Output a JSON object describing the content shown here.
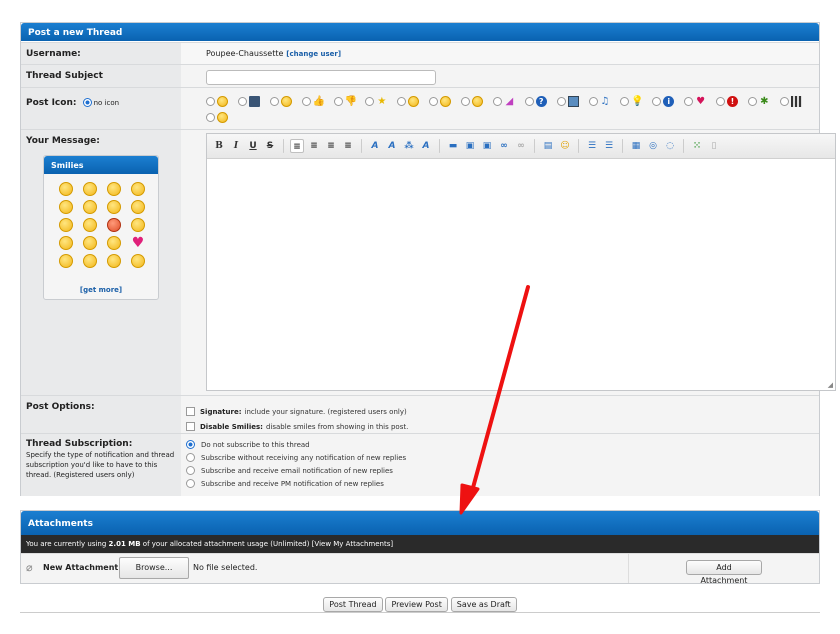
{
  "thread_form": {
    "header": "Post a new Thread",
    "username_label": "Username:",
    "username_value": "Poupee-Chaussette",
    "change_user": "[change user]",
    "subject_label": "Thread Subject",
    "subject_value": "",
    "post_icon_label": "Post Icon:",
    "no_icon": "no icon",
    "message_label": "Your Message:"
  },
  "smilies": {
    "header": "Smilies",
    "get_more": "[get more]"
  },
  "toolbar": {
    "bold": "B",
    "italic": "I",
    "underline": "U",
    "strike": "S"
  },
  "options": {
    "post_options_label": "Post Options:",
    "signature_bold": "Signature:",
    "signature_text": "include your signature. (registered users only)",
    "smilies_bold": "Disable Smilies:",
    "smilies_text": "disable smiles from showing in this post.",
    "subscription_label": "Thread Subscription:",
    "subscription_desc": "Specify the type of notification and thread subscription you'd like to have to this thread. (Registered users only)",
    "subscription_choices": [
      "Do not subscribe to this thread",
      "Subscribe without receiving any notification of new replies",
      "Subscribe and receive email notification of new replies",
      "Subscribe and receive PM notification of new replies"
    ]
  },
  "attachments": {
    "header": "Attachments",
    "usage_prefix": "You are currently using",
    "usage_amount": "2.01 MB",
    "usage_suffix": "of your allocated attachment usage (Unlimited)",
    "view_link": "[View My Attachments]",
    "new_label": "New Attachment:",
    "browse": "Browse...",
    "no_file": "No file selected.",
    "add_button": "Add Attachment"
  },
  "actions": {
    "post": "Post Thread",
    "preview": "Preview Post",
    "draft": "Save as Draft"
  },
  "colors": {
    "header_blue": "#0a62b0",
    "arrow_red": "#ee1111",
    "link_blue": "#1a5fa8"
  }
}
